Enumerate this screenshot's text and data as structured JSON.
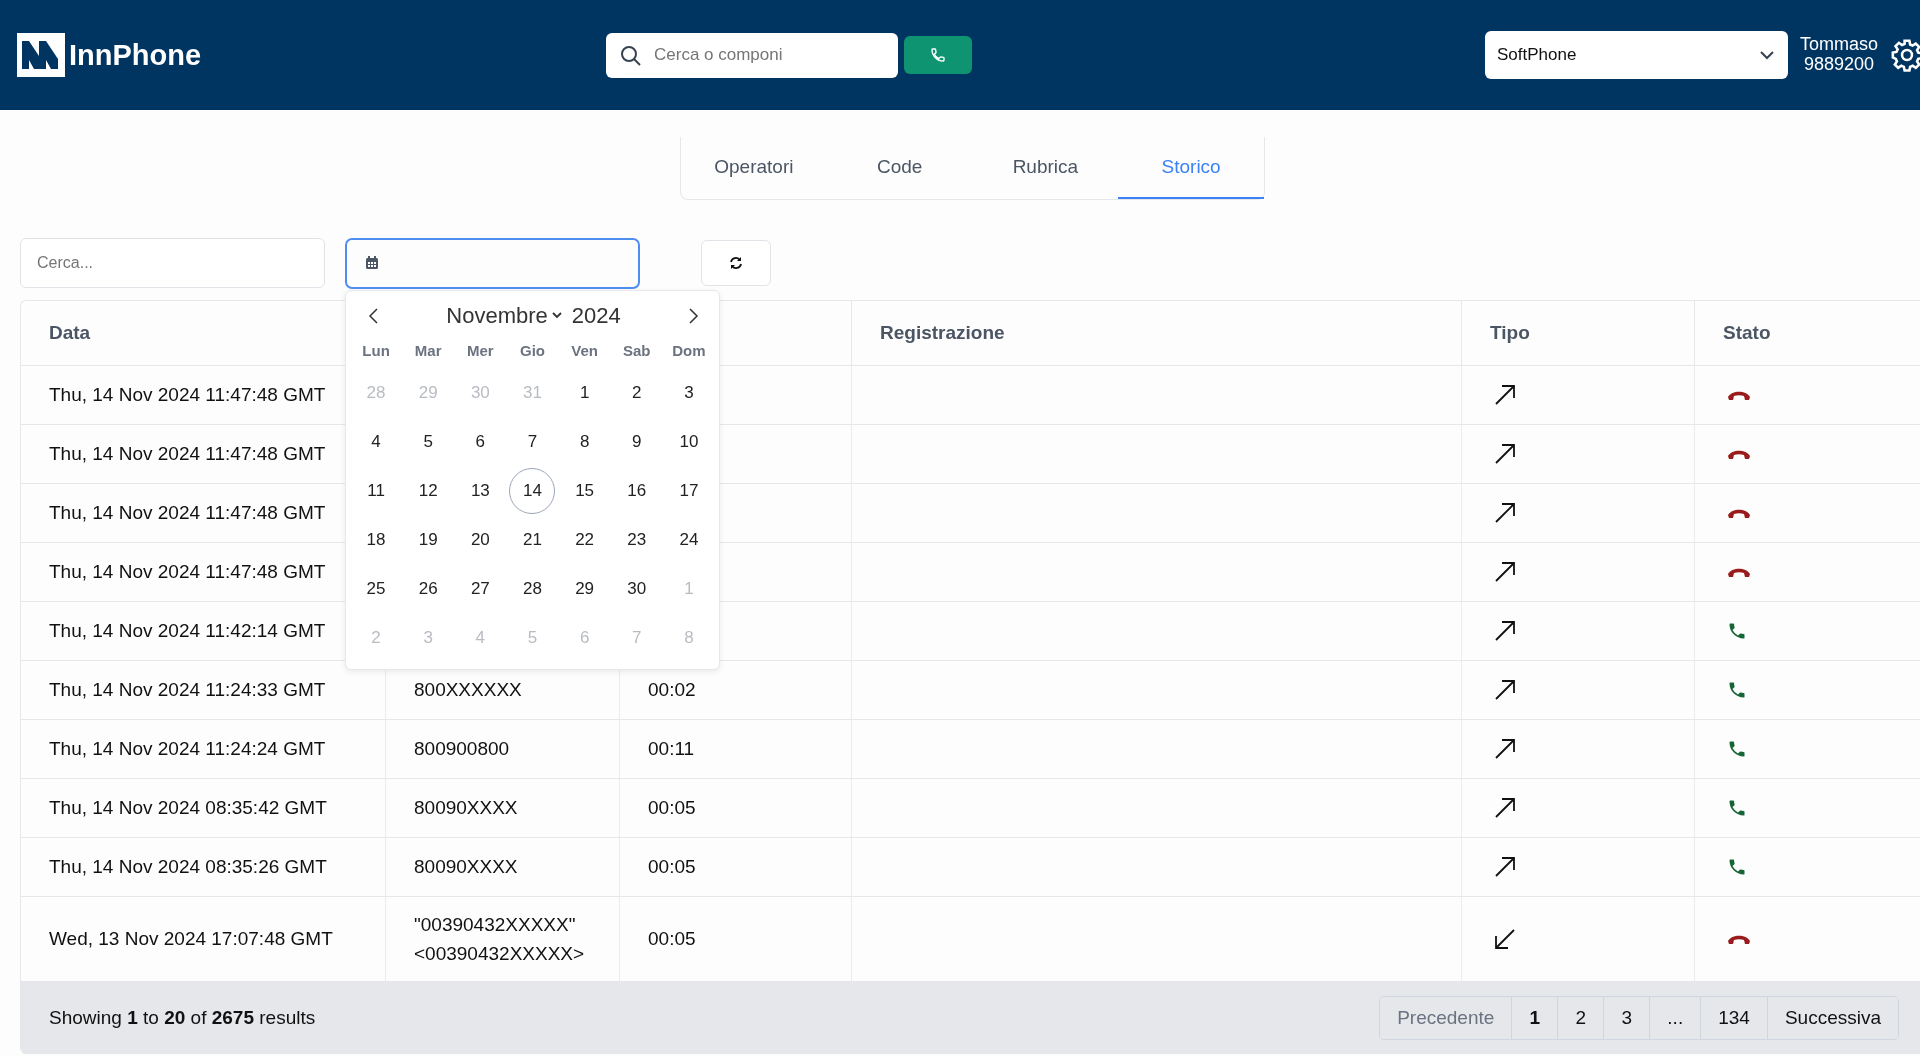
{
  "header": {
    "brand": "InnPhone",
    "search": {
      "placeholder": "Cerca o componi"
    },
    "device_select": {
      "value": "SoftPhone"
    },
    "user": {
      "name": "Tommaso",
      "extension": "9889200"
    }
  },
  "tabs": [
    {
      "label": "Operatori",
      "selected": false
    },
    {
      "label": "Code",
      "selected": false
    },
    {
      "label": "Rubrica",
      "selected": false
    },
    {
      "label": "Storico",
      "selected": true
    }
  ],
  "filters": {
    "search": {
      "placeholder": "Cerca..."
    }
  },
  "datepicker": {
    "month": "Novembre",
    "year": "2024",
    "weekdays": [
      "Lun",
      "Mar",
      "Mer",
      "Gio",
      "Ven",
      "Sab",
      "Dom"
    ],
    "weeks": [
      [
        {
          "label": "28",
          "outside": true,
          "today": false
        },
        {
          "label": "29",
          "outside": true,
          "today": false
        },
        {
          "label": "30",
          "outside": true,
          "today": false
        },
        {
          "label": "31",
          "outside": true,
          "today": false
        },
        {
          "label": "1",
          "outside": false,
          "today": false
        },
        {
          "label": "2",
          "outside": false,
          "today": false
        },
        {
          "label": "3",
          "outside": false,
          "today": false
        }
      ],
      [
        {
          "label": "4",
          "outside": false,
          "today": false
        },
        {
          "label": "5",
          "outside": false,
          "today": false
        },
        {
          "label": "6",
          "outside": false,
          "today": false
        },
        {
          "label": "7",
          "outside": false,
          "today": false
        },
        {
          "label": "8",
          "outside": false,
          "today": false
        },
        {
          "label": "9",
          "outside": false,
          "today": false
        },
        {
          "label": "10",
          "outside": false,
          "today": false
        }
      ],
      [
        {
          "label": "11",
          "outside": false,
          "today": false
        },
        {
          "label": "12",
          "outside": false,
          "today": false
        },
        {
          "label": "13",
          "outside": false,
          "today": false
        },
        {
          "label": "14",
          "outside": false,
          "today": true
        },
        {
          "label": "15",
          "outside": false,
          "today": false
        },
        {
          "label": "16",
          "outside": false,
          "today": false
        },
        {
          "label": "17",
          "outside": false,
          "today": false
        }
      ],
      [
        {
          "label": "18",
          "outside": false,
          "today": false
        },
        {
          "label": "19",
          "outside": false,
          "today": false
        },
        {
          "label": "20",
          "outside": false,
          "today": false
        },
        {
          "label": "21",
          "outside": false,
          "today": false
        },
        {
          "label": "22",
          "outside": false,
          "today": false
        },
        {
          "label": "23",
          "outside": false,
          "today": false
        },
        {
          "label": "24",
          "outside": false,
          "today": false
        }
      ],
      [
        {
          "label": "25",
          "outside": false,
          "today": false
        },
        {
          "label": "26",
          "outside": false,
          "today": false
        },
        {
          "label": "27",
          "outside": false,
          "today": false
        },
        {
          "label": "28",
          "outside": false,
          "today": false
        },
        {
          "label": "29",
          "outside": false,
          "today": false
        },
        {
          "label": "30",
          "outside": false,
          "today": false
        },
        {
          "label": "1",
          "outside": true,
          "today": false
        }
      ],
      [
        {
          "label": "2",
          "outside": true,
          "today": false
        },
        {
          "label": "3",
          "outside": true,
          "today": false
        },
        {
          "label": "4",
          "outside": true,
          "today": false
        },
        {
          "label": "5",
          "outside": true,
          "today": false
        },
        {
          "label": "6",
          "outside": true,
          "today": false
        },
        {
          "label": "7",
          "outside": true,
          "today": false
        },
        {
          "label": "8",
          "outside": true,
          "today": false
        }
      ]
    ]
  },
  "table": {
    "columns": [
      "Data",
      "",
      "",
      "Registrazione",
      "Tipo",
      "Stato"
    ],
    "rows": [
      {
        "date": "Thu, 14 Nov 2024 11:47:48 GMT",
        "outgoing": true,
        "answered": false
      },
      {
        "date": "Thu, 14 Nov 2024 11:47:48 GMT",
        "outgoing": true,
        "answered": false
      },
      {
        "date": "Thu, 14 Nov 2024 11:47:48 GMT",
        "outgoing": true,
        "answered": false
      },
      {
        "date": "Thu, 14 Nov 2024 11:47:48 GMT",
        "outgoing": true,
        "answered": false
      },
      {
        "date": "Thu, 14 Nov 2024 11:42:14 GMT",
        "outgoing": true,
        "answered": true
      },
      {
        "date": "Thu, 14 Nov 2024 11:24:33 GMT",
        "number": "800XXXXXX",
        "duration": "00:02",
        "outgoing": true,
        "answered": true
      },
      {
        "date": "Thu, 14 Nov 2024 11:24:24 GMT",
        "number": "800900800",
        "duration": "00:11",
        "outgoing": true,
        "answered": true
      },
      {
        "date": "Thu, 14 Nov 2024 08:35:42 GMT",
        "number": "80090XXXX",
        "duration": "00:05",
        "outgoing": true,
        "answered": true
      },
      {
        "date": "Thu, 14 Nov 2024 08:35:26 GMT",
        "number": "80090XXXX",
        "duration": "00:05",
        "outgoing": true,
        "answered": true
      },
      {
        "date": "Wed, 13 Nov 2024 17:07:48 GMT",
        "number": "\"00390432XXXXX\" <00390432XXXXX>",
        "duration": "00:05",
        "outgoing": false,
        "answered": false
      }
    ]
  },
  "footer": {
    "summary": "Showing **1** to **20** of **2675** results",
    "pagination": {
      "previous": {
        "label": "Precedente",
        "disabled": true
      },
      "pages": [
        {
          "label": "1",
          "selected": true
        },
        {
          "label": "2",
          "selected": false
        },
        {
          "label": "3",
          "selected": false
        },
        {
          "label": "...",
          "selected": false
        },
        {
          "label": "134",
          "selected": false
        }
      ],
      "next": {
        "label": "Successiva",
        "disabled": false
      }
    }
  }
}
